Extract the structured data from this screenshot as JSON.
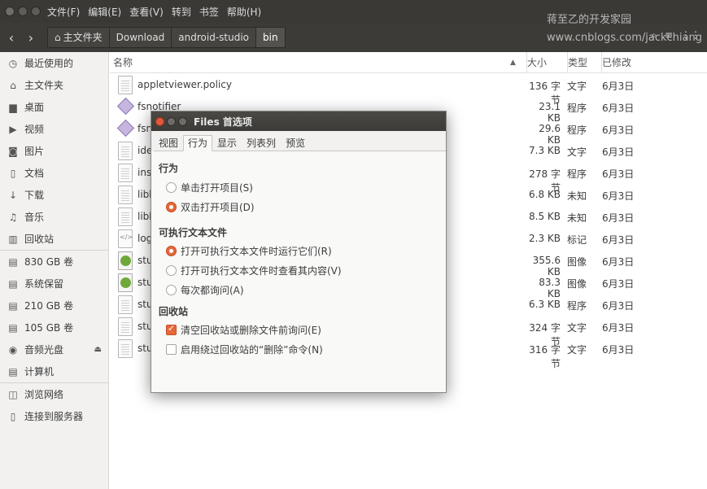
{
  "menubar": {
    "items": [
      "文件(F)",
      "编辑(E)",
      "查看(V)",
      "转到",
      "书签",
      "帮助(H)"
    ]
  },
  "toolbar": {
    "back_icon": "chevron-left-icon",
    "forward_icon": "chevron-right-icon",
    "breadcrumbs": [
      "主文件夹",
      "Download",
      "android-studio",
      "bin"
    ],
    "right_icons": [
      "search-icon",
      "list-view-icon",
      "grid-view-icon"
    ]
  },
  "watermark": {
    "line1": "蒋至乙的开发家园",
    "line2": "www.cnblogs.com/jackchiang"
  },
  "sidebar": {
    "items": [
      {
        "label": "最近使用的",
        "icon": "clock-icon",
        "glyph": "◷"
      },
      {
        "label": "主文件夹",
        "icon": "home-icon",
        "glyph": "⌂"
      },
      {
        "label": "桌面",
        "icon": "folder-icon",
        "glyph": "▆"
      },
      {
        "label": "视频",
        "icon": "video-icon",
        "glyph": "▶"
      },
      {
        "label": "图片",
        "icon": "camera-icon",
        "glyph": "◙"
      },
      {
        "label": "文档",
        "icon": "document-icon",
        "glyph": "▯"
      },
      {
        "label": "下载",
        "icon": "download-icon",
        "glyph": "↓"
      },
      {
        "label": "音乐",
        "icon": "music-icon",
        "glyph": "♫"
      },
      {
        "label": "回收站",
        "icon": "trash-icon",
        "glyph": "▥"
      }
    ],
    "devices": [
      {
        "label": "830 GB 卷",
        "icon": "drive-icon",
        "glyph": "▤"
      },
      {
        "label": "系统保留",
        "icon": "drive-icon",
        "glyph": "▤"
      },
      {
        "label": "210 GB 卷",
        "icon": "drive-icon",
        "glyph": "▤"
      },
      {
        "label": "105 GB 卷",
        "icon": "drive-icon",
        "glyph": "▤"
      },
      {
        "label": "音频光盘",
        "icon": "cd-icon",
        "glyph": "◉",
        "eject": "⏏"
      },
      {
        "label": "计算机",
        "icon": "computer-icon",
        "glyph": "▤"
      }
    ],
    "network": [
      {
        "label": "浏览网络",
        "icon": "network-icon",
        "glyph": "◫"
      },
      {
        "label": "连接到服务器",
        "icon": "server-icon",
        "glyph": "▯"
      }
    ]
  },
  "filelist": {
    "headers": {
      "name": "名称",
      "size": "大小",
      "type": "类型",
      "modified": "已修改"
    },
    "rows": [
      {
        "name": "appletviewer.policy",
        "size": "136 字节",
        "type": "文字",
        "modified": "6月3日",
        "icon": "text"
      },
      {
        "name": "fsnotifier",
        "size": "23.1 KB",
        "type": "程序",
        "modified": "6月3日",
        "icon": "exec"
      },
      {
        "name": "fsn",
        "size": "29.6 KB",
        "type": "程序",
        "modified": "6月3日",
        "icon": "exec"
      },
      {
        "name": "ide",
        "size": "7.3 KB",
        "type": "文字",
        "modified": "6月3日",
        "icon": "text"
      },
      {
        "name": "insp",
        "size": "278 字节",
        "type": "程序",
        "modified": "6月3日",
        "icon": "text"
      },
      {
        "name": "libb",
        "size": "6.8 KB",
        "type": "未知",
        "modified": "6月3日",
        "icon": "text"
      },
      {
        "name": "libb",
        "size": "8.5 KB",
        "type": "未知",
        "modified": "6月3日",
        "icon": "text"
      },
      {
        "name": "log",
        "size": "2.3 KB",
        "type": "标记",
        "modified": "6月3日",
        "icon": "xml"
      },
      {
        "name": "stu",
        "size": "355.6 KB",
        "type": "图像",
        "modified": "6月3日",
        "icon": "img"
      },
      {
        "name": "stu",
        "size": "83.3 KB",
        "type": "图像",
        "modified": "6月3日",
        "icon": "img"
      },
      {
        "name": "stu",
        "size": "6.3 KB",
        "type": "程序",
        "modified": "6月3日",
        "icon": "text"
      },
      {
        "name": "stu",
        "size": "324 字节",
        "type": "文字",
        "modified": "6月3日",
        "icon": "text"
      },
      {
        "name": "stu",
        "size": "316 字节",
        "type": "文字",
        "modified": "6月3日",
        "icon": "text"
      }
    ]
  },
  "dialog": {
    "title": "Files 首选项",
    "tabs": [
      "视图",
      "行为",
      "显示",
      "列表列",
      "预览"
    ],
    "active_tab": 1,
    "section1": {
      "title": "行为",
      "options": [
        {
          "label": "单击打开项目(S)",
          "checked": false
        },
        {
          "label": "双击打开项目(D)",
          "checked": true
        }
      ]
    },
    "section2": {
      "title": "可执行文本文件",
      "options": [
        {
          "label": "打开可执行文本文件时运行它们(R)",
          "checked": true
        },
        {
          "label": "打开可执行文本文件时查看其内容(V)",
          "checked": false
        },
        {
          "label": "每次都询问(A)",
          "checked": false
        }
      ]
    },
    "section3": {
      "title": "回收站",
      "options": [
        {
          "label": "清空回收站或删除文件前询问(E)",
          "checked": true
        },
        {
          "label": "启用绕过回收站的“删除”命令(N)",
          "checked": false
        }
      ]
    }
  }
}
